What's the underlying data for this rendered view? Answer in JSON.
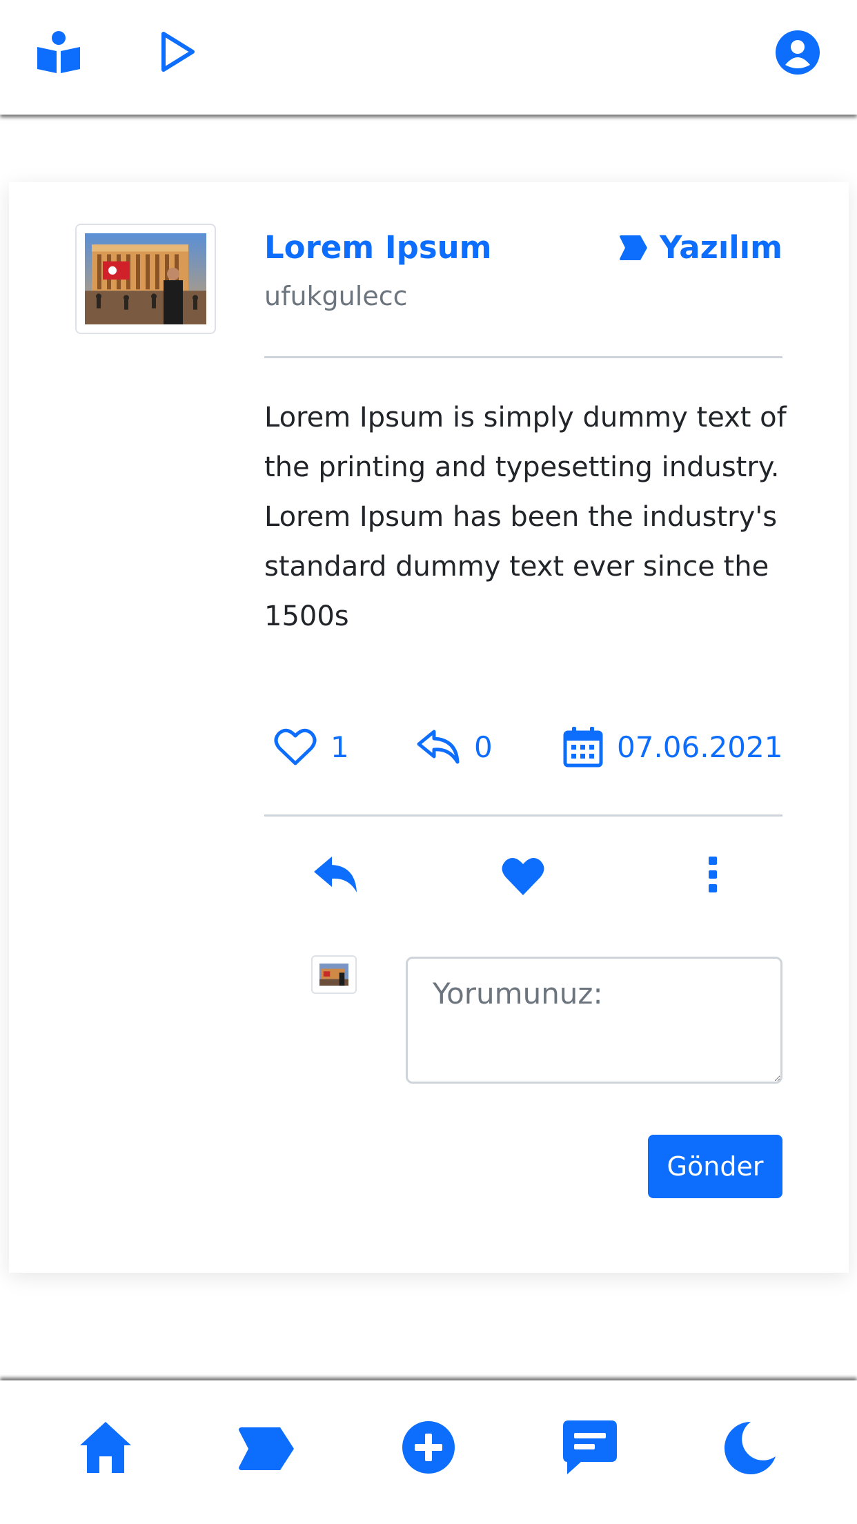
{
  "colors": {
    "accent": "#0d6efd",
    "muted": "#6c757d",
    "text": "#212529",
    "divider": "#ced4da"
  },
  "topbar": {
    "left_icons": [
      "book-reader-icon",
      "play-icon"
    ],
    "right_icon": "user-circle-icon"
  },
  "post": {
    "title": "Lorem Ipsum",
    "username": "ufukgulecc",
    "category": "Yazılım",
    "category_icon": "tag-icon",
    "body": "Lorem Ipsum is simply dummy text of the printing and typesetting industry. Lorem Ipsum has been the industry's standard dummy text ever since the 1500s",
    "likes": "1",
    "replies": "0",
    "date": "07.06.2021"
  },
  "actions": [
    "reply-icon",
    "heart-icon",
    "more-vertical-icon"
  ],
  "comment": {
    "placeholder": "Yorumunuz:",
    "send_label": "Gönder"
  },
  "bottom_nav": [
    "home-icon",
    "tag-icon",
    "add-icon",
    "message-icon",
    "moon-icon"
  ]
}
